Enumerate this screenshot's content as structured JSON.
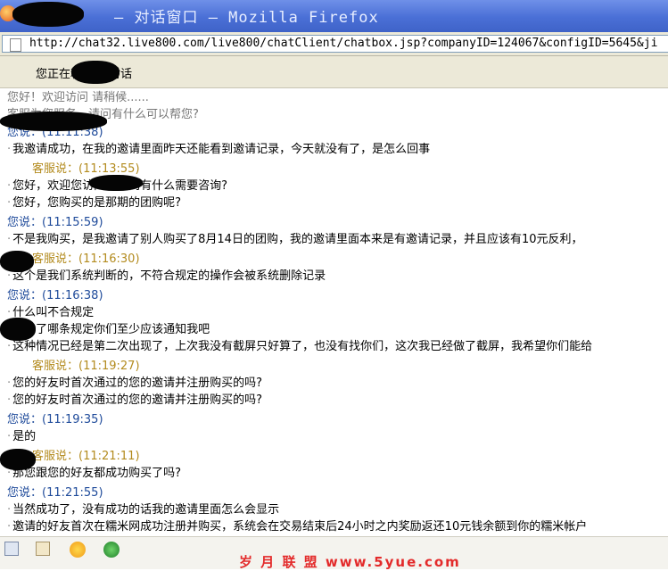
{
  "window": {
    "title": "— 对话窗口 — Mozilla Firefox"
  },
  "address_bar": {
    "url": "http://chat32.live800.com/live800/chatClient/chatbox.jsp?companyID=124067&configID=5645&ji"
  },
  "status": {
    "text": "您正在和              客服对话"
  },
  "chat": {
    "system_lines": [
      "您好！欢迎访问                   请稍候......",
      "       客服为您服务，请问有什么可以帮您?"
    ],
    "blocks": [
      {
        "speaker": "您说：(11:11:38)",
        "role": "me",
        "lines": [
          "我邀请成功，在我的邀请里面昨天还能看到邀请记录，今天就没有了，是怎么回事"
        ]
      },
      {
        "speaker": "客服说：(11:13:55)",
        "role": "agent",
        "lines": [
          "您好，欢迎您访问！请问有什么需要咨询?",
          "您好，您购买的是那期的团购呢?"
        ]
      },
      {
        "speaker": "您说：(11:15:59)",
        "role": "me",
        "lines": [
          "不是我购买，是我邀请了别人购买了8月14日的团购，我的邀请里面本来是有邀请记录，并且应该有10元反利，"
        ]
      },
      {
        "speaker": "客服说：(11:16:30)",
        "role": "agent",
        "lines": [
          "这个是我们系统判断的，不符合规定的操作会被系统删除记录"
        ]
      },
      {
        "speaker": "您说：(11:16:38)",
        "role": "me",
        "lines": [
          "什么叫不合规定",
          "不合了哪条规定你们至少应该通知我吧",
          "这种情况已经是第二次出现了，上次我没有截屏只好算了，也没有找你们，这次我已经做了截屏，我希望你们能给"
        ]
      },
      {
        "speaker": "客服说：(11:19:27)",
        "role": "agent",
        "lines": [
          "您的好友时首次通过的您的邀请并注册购买的吗?",
          "您的好友时首次通过的您的邀请并注册购买的吗?"
        ]
      },
      {
        "speaker": "您说：(11:19:35)",
        "role": "me",
        "lines": [
          "是的"
        ]
      },
      {
        "speaker": "客服说：(11:21:11)",
        "role": "agent",
        "lines": [
          "那您跟您的好友都成功购买了吗?"
        ]
      },
      {
        "speaker": "您说：(11:21:55)",
        "role": "me",
        "lines": [
          "当然成功了，没有成功的话我的邀请里面怎么会显示",
          "邀请的好友首次在糯米网成功注册并购买，系统会在交易结束后24小时之内奖励返还10元钱余额到你的糯米帐户"
        ]
      }
    ]
  },
  "footer": {
    "watermark": "岁 月 联 盟   www.5yue.com"
  },
  "colors": {
    "titlebar": "#4a6fd6",
    "me": "#1e4a9a",
    "agent": "#b38b1e",
    "watermark": "#e32a2a"
  }
}
